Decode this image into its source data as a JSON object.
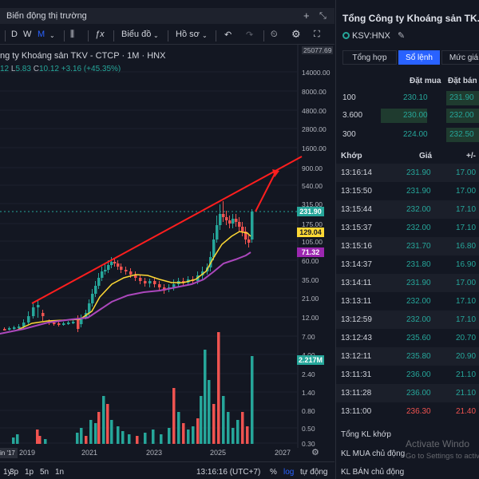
{
  "chart_panel": {
    "title": "Biến động thị trường",
    "toolbar": {
      "interval_d": "D",
      "interval_w": "W",
      "interval_m": "M",
      "indicators": "Biểu đồ",
      "profile": "Hồ sơ"
    },
    "legend_title": "ng ty Khoáng sản TKV - CTCP · 1M · HNX",
    "legend_values": {
      "o_part": "12",
      "l_label": "L",
      "l_value": "5.83",
      "c_label": "C",
      "c_value": "10.12",
      "change": "+3.16 (+45.35%)"
    },
    "top_value": "25077.69",
    "y_axis_labels": [
      "14000.00",
      "8000.00",
      "4800.00",
      "2800.00",
      "1600.00",
      "900.00",
      "540.00",
      "315.00",
      "175.00",
      "105.00",
      "60.00",
      "35.00",
      "21.00",
      "12.00",
      "7.00",
      "4.00",
      "2.40",
      "1.40",
      "0.80",
      "0.50",
      "0.30"
    ],
    "price_tags": {
      "last": "231.90",
      "ma_yellow": "129.04",
      "ma_purple": "71.32",
      "volume": "2.217M"
    },
    "x_axis_labels": [
      "2019",
      "2021",
      "2023",
      "2025",
      "2027"
    ],
    "date_corner": "in '17",
    "bottom_bar": {
      "ranges": [
        "1y",
        "3p",
        "1p",
        "5n",
        "1n"
      ],
      "time": "13:16:16 (UTC+7)",
      "percent": "%",
      "log": "log",
      "auto": "tự động"
    },
    "colors": {
      "up": "#26a69a",
      "down": "#ef5350",
      "trend": "#ff1e1e",
      "ma_yellow": "#fdd835",
      "ma_purple": "#ab47bc",
      "accent": "#2962ff"
    }
  },
  "chart_data": {
    "type": "line",
    "title": "ng ty Khoáng sản TKV - CTCP · 1M · HNX",
    "x_labels": [
      "2019",
      "2021",
      "2023",
      "2025",
      "2027"
    ],
    "y_scale": "log",
    "ylim": [
      0.3,
      14000
    ],
    "series": [
      {
        "name": "",
        "values": [
          9,
          10,
          15,
          45,
          40,
          35,
          28,
          25,
          32,
          60,
          240,
          200,
          231.9
        ]
      },
      {
        "name": "",
        "values": [
          9,
          9.5,
          11,
          26,
          35,
          33,
          28,
          27,
          30,
          50,
          110,
          129.04
        ]
      },
      {
        "name": "",
        "values": [
          8,
          9,
          10,
          14,
          22,
          26,
          25,
          24,
          26,
          34,
          55,
          71.32
        ]
      }
    ],
    "volume_scale_max": "2.217M"
  },
  "right_panel": {
    "title": "Tổng Công ty Khoáng sản TK...",
    "symbol": "KSV:HNX",
    "tabs": [
      "Tổng hợp",
      "Sổ lệnh",
      "Mức giá"
    ],
    "orderbook": {
      "head_bid": "Đặt mua",
      "head_ask": "Đặt bán",
      "rows": [
        {
          "vol": "100",
          "bid": "230.10",
          "ask": "231.90"
        },
        {
          "vol": "3.600",
          "bid": "230.00",
          "ask": "232.00"
        },
        {
          "vol": "300",
          "bid": "224.00",
          "ask": "232.50"
        }
      ]
    },
    "trades": {
      "head_time": "Khớp",
      "head_price": "Giá",
      "head_change": "+/-",
      "rows": [
        {
          "time": "13:16:14",
          "price": "231.90",
          "change": "17.00"
        },
        {
          "time": "13:15:50",
          "price": "231.90",
          "change": "17.00"
        },
        {
          "time": "13:15:44",
          "price": "232.00",
          "change": "17.10"
        },
        {
          "time": "13:15:37",
          "price": "232.00",
          "change": "17.10"
        },
        {
          "time": "13:15:16",
          "price": "231.70",
          "change": "16.80"
        },
        {
          "time": "13:14:37",
          "price": "231.80",
          "change": "16.90"
        },
        {
          "time": "13:14:11",
          "price": "231.90",
          "change": "17.00"
        },
        {
          "time": "13:13:11",
          "price": "232.00",
          "change": "17.10"
        },
        {
          "time": "13:12:59",
          "price": "232.00",
          "change": "17.10"
        },
        {
          "time": "13:12:43",
          "price": "235.60",
          "change": "20.70"
        },
        {
          "time": "13:12:11",
          "price": "235.80",
          "change": "20.90"
        },
        {
          "time": "13:11:31",
          "price": "236.00",
          "change": "21.10"
        },
        {
          "time": "13:11:28",
          "price": "236.00",
          "change": "21.10"
        },
        {
          "time": "13:11:00",
          "price": "236.30",
          "change": "21.40"
        }
      ]
    },
    "summary": {
      "total_label": "Tổng KL khớp",
      "buy_label": "KL MUA chủ động",
      "sell_label": "KL BÁN chủ động"
    }
  },
  "watermark": {
    "line1": "Activate Windo",
    "line2": "Go to Settings to activ"
  }
}
